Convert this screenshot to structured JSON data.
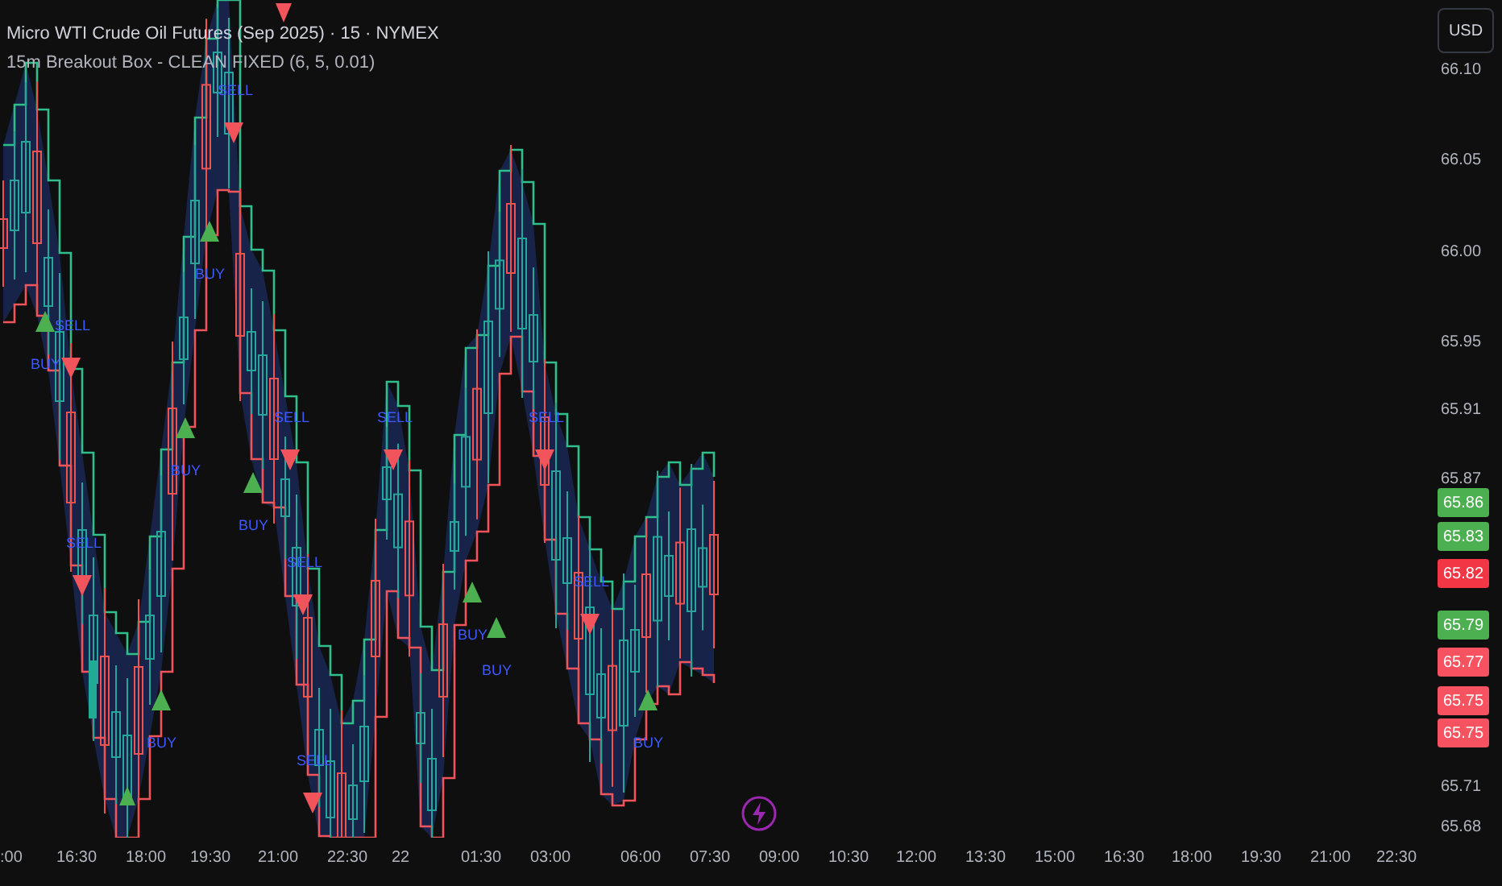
{
  "legend": {
    "symbol": "Micro WTI Crude Oil Futures (Sep 2025) · 15 · NYMEX",
    "indicator": "15m Breakout Box - CLEAN FIXED (6, 5, 0.01)"
  },
  "currency_button": "USD",
  "price_ticks": [
    "66.10",
    "66.05",
    "66.00",
    "65.95",
    "65.91",
    "65.87",
    "65.71",
    "65.68"
  ],
  "price_tags": [
    {
      "value": "65.86",
      "color": "#4caf50"
    },
    {
      "value": "65.83",
      "color": "#4caf50"
    },
    {
      "value": "65.82",
      "color": "#f23645"
    },
    {
      "value": "65.79",
      "color": "#4caf50"
    },
    {
      "value": "65.77",
      "color": "#f7525f"
    },
    {
      "value": "65.75",
      "color": "#f7525f"
    },
    {
      "value": "65.75",
      "color": "#f7525f"
    }
  ],
  "time_ticks": [
    ":00",
    "16:30",
    "18:00",
    "19:30",
    "21:00",
    "22:30",
    "22",
    "01:30",
    "03:00",
    "06:00",
    "07:30",
    "09:00",
    "10:30",
    "12:00",
    "13:30",
    "15:00",
    "16:30",
    "18:00",
    "19:30",
    "21:00",
    "22:30"
  ],
  "signals": [
    {
      "kind": "sell",
      "label": "SELL"
    },
    {
      "kind": "buy",
      "label": "BUY"
    },
    {
      "kind": "sell",
      "label": "SELL"
    },
    {
      "kind": "buy",
      "label": "BUY"
    },
    {
      "kind": "sell",
      "label": "SELL"
    },
    {
      "kind": "sell",
      "label": "SELL"
    },
    {
      "kind": "sell",
      "label": "SELL"
    },
    {
      "kind": "buy",
      "label": "BUY"
    },
    {
      "kind": "buy",
      "label": "BUY"
    },
    {
      "kind": "sell",
      "label": "SELL"
    },
    {
      "kind": "sell",
      "label": "SELL"
    },
    {
      "kind": "sell",
      "label": "SELL"
    },
    {
      "kind": "buy",
      "label": "BUY"
    },
    {
      "kind": "buy",
      "label": "BUY"
    },
    {
      "kind": "buy",
      "label": "BUY"
    },
    {
      "kind": "buy",
      "label": "BUY"
    },
    {
      "kind": "sell",
      "label": "SELL"
    }
  ]
}
